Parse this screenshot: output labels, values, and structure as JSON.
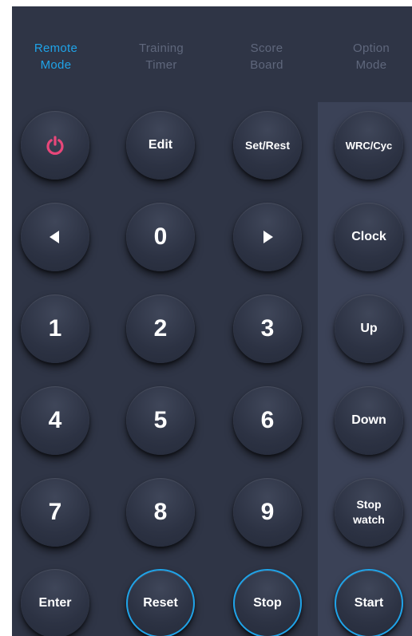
{
  "tabs": [
    {
      "line1": "Remote",
      "line2": "Mode",
      "active": true
    },
    {
      "line1": "Training",
      "line2": "Timer",
      "active": false
    },
    {
      "line1": "Score",
      "line2": "Board",
      "active": false
    },
    {
      "line1": "Option",
      "line2": "Mode",
      "active": false
    }
  ],
  "icons": {
    "power": "power-icon",
    "left": "arrow-left-icon",
    "right": "arrow-right-icon"
  },
  "colors": {
    "accent": "#1fa3e8",
    "power": "#e8477a",
    "background": "#2f3546",
    "panel": "#3b4257"
  },
  "keypad": {
    "edit": "Edit",
    "set_rest": "Set/Rest",
    "zero": "0",
    "one": "1",
    "two": "2",
    "three": "3",
    "four": "4",
    "five": "5",
    "six": "6",
    "seven": "7",
    "eight": "8",
    "nine": "9",
    "enter": "Enter",
    "reset": "Reset",
    "stop": "Stop"
  },
  "side": {
    "wrc_cyc": "WRC/Cyc",
    "clock": "Clock",
    "up": "Up",
    "down": "Down",
    "stopwatch_line1": "Stop",
    "stopwatch_line2": "watch",
    "start": "Start"
  }
}
